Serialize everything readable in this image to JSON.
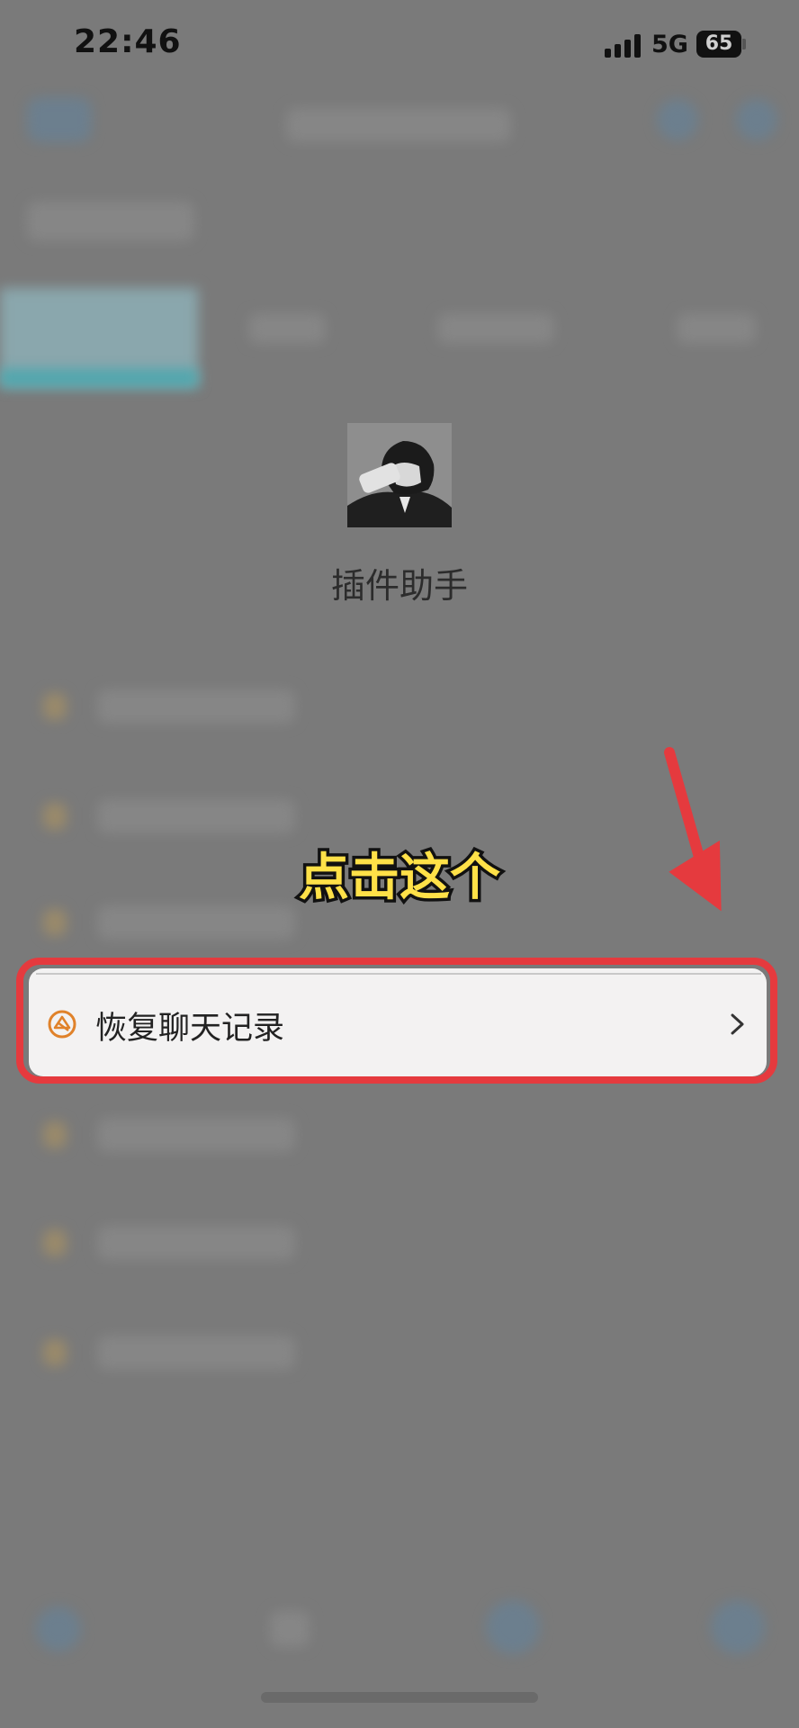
{
  "status_bar": {
    "time": "22:46",
    "network": "5G",
    "battery": "65"
  },
  "profile": {
    "avatar_icon": "avatar-image",
    "name": "插件助手"
  },
  "annotation": {
    "text": "点击这个",
    "text_color": "#ffe148",
    "arrow_color": "#e53a3e"
  },
  "menu": {
    "highlighted_item": {
      "label": "恢复聊天记录",
      "icon": "restore-icon",
      "icon_color": "#e0822a",
      "chevron_icon": "chevron-right-icon"
    },
    "highlight_color": "#e53a3e"
  },
  "colors": {
    "overlay": "#7a7a7a",
    "tab_accent": "#4fa7ae"
  }
}
